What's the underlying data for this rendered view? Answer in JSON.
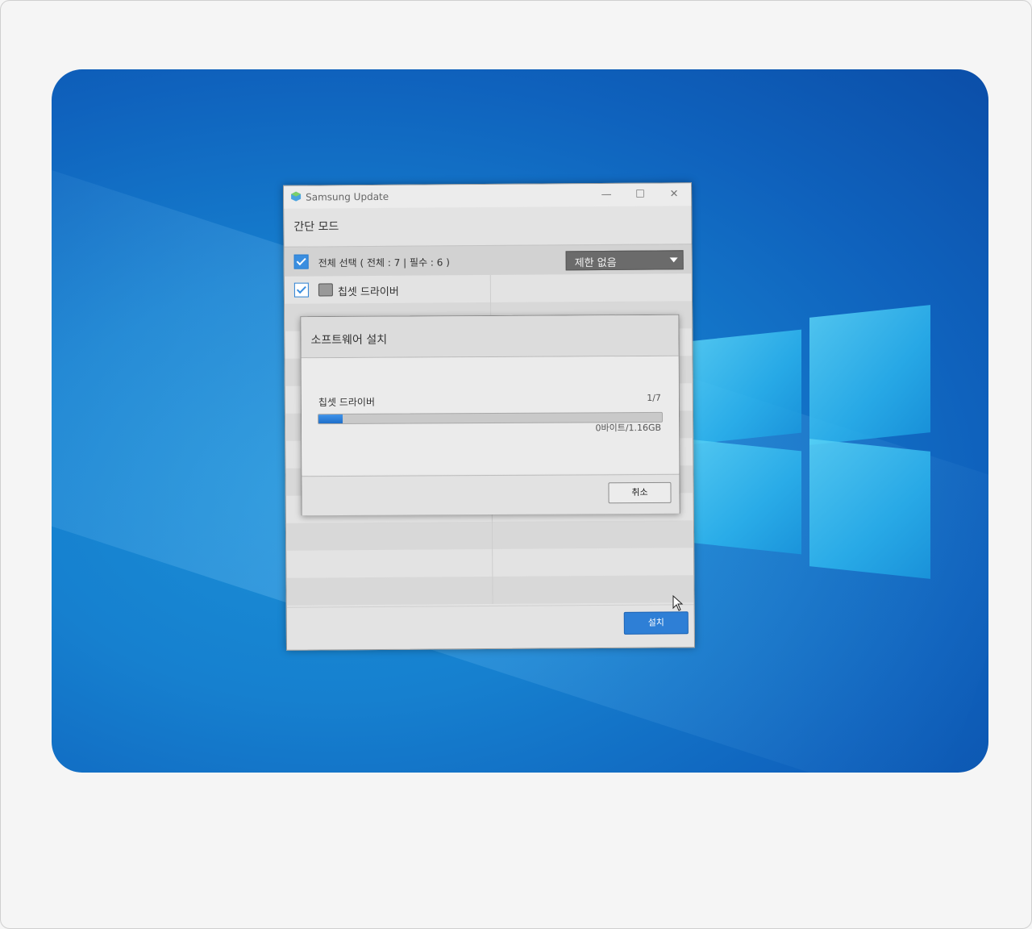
{
  "window": {
    "title": "Samsung Update",
    "mode": "간단 모드",
    "minimize_glyph": "—",
    "maximize_glyph": "☐",
    "close_glyph": "✕"
  },
  "select_all": {
    "label": "전체 선택 ( 전체 : 7 | 필수 : 6 )",
    "checked": true
  },
  "filter_dropdown": {
    "value": "제한 없음"
  },
  "drivers": [
    {
      "label": "칩셋 드라이버",
      "checked": true,
      "icon": "chipset-icon"
    }
  ],
  "install_button": {
    "label": "설치"
  },
  "dialog": {
    "title": "소프트웨어 설치",
    "current_item": "칩셋 드라이버",
    "counter": "1/7",
    "progress": 0.07,
    "size_text": "0바이트/1.16GB",
    "cancel_label": "취소"
  },
  "colors": {
    "accent": "#2e7fd6",
    "desktop": "#1680cf"
  }
}
